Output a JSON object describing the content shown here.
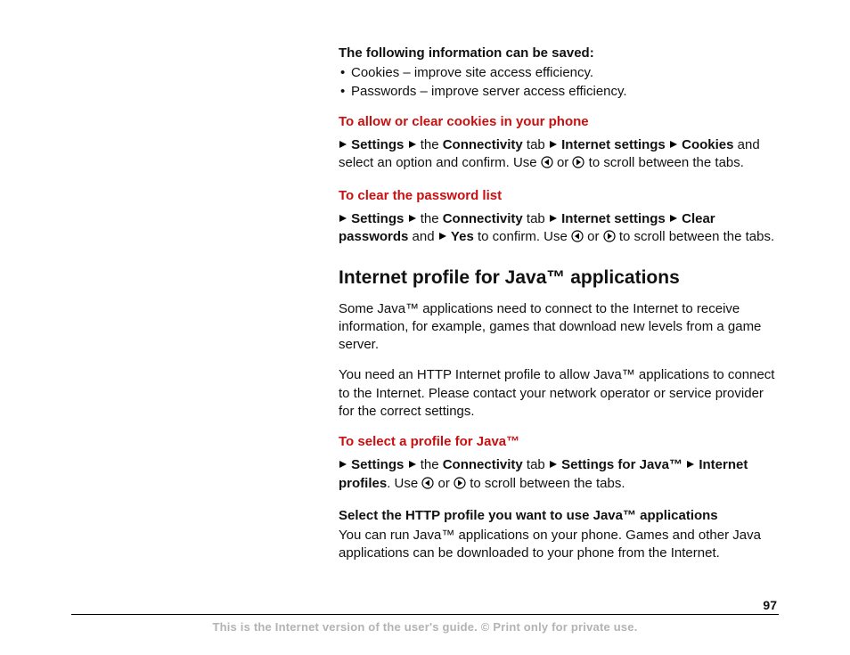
{
  "intro": {
    "lead": "The following information can be saved:",
    "bullets": [
      "Cookies – improve site access efficiency.",
      "Passwords – improve server access efficiency."
    ]
  },
  "cookies": {
    "heading": "To allow or clear cookies in your phone",
    "strong1": "Settings",
    "seg1": " the ",
    "strong2": "Connectivity",
    "seg2": " tab ",
    "strong3": "Internet settings",
    "strong4": "Cookies",
    "tail1": " and select an option and confirm. Use ",
    "tail2": " or ",
    "tail3": " to scroll between the tabs."
  },
  "passwords": {
    "heading": "To clear the password list",
    "strong1": "Settings",
    "seg1": " the ",
    "strong2": "Connectivity",
    "seg2": " tab ",
    "strong3": "Internet settings",
    "strong4": "Clear passwords",
    "tail1": " and ",
    "strong5": "Yes",
    "tail2": " to confirm. Use ",
    "tail3": " or ",
    "tail4": " to scroll between the tabs."
  },
  "java_section": {
    "title": "Internet profile for Java™ applications",
    "p1": "Some Java™ applications need to connect to the Internet to receive information, for example, games that download new levels from a game server.",
    "p2": "You need an HTTP Internet profile to allow Java™ applications to connect to the Internet. Please contact your network operator or service provider for the correct settings."
  },
  "java_profile": {
    "heading": "To select a profile for Java™",
    "strong1": "Settings",
    "seg1": " the ",
    "strong2": "Connectivity",
    "seg2": " tab ",
    "strong3": "Settings for Java™",
    "strong4": "Internet profiles",
    "tail1": ". Use ",
    "tail2": " or ",
    "tail3": " to scroll between the tabs."
  },
  "http_profile": {
    "lead": "Select the HTTP profile you want to use Java™ applications",
    "body": "You can run Java™ applications on your phone. Games and other Java applications can be downloaded to your phone from the Internet."
  },
  "page_number": "97",
  "footer": "This is the Internet version of the user's guide. © Print only for private use."
}
